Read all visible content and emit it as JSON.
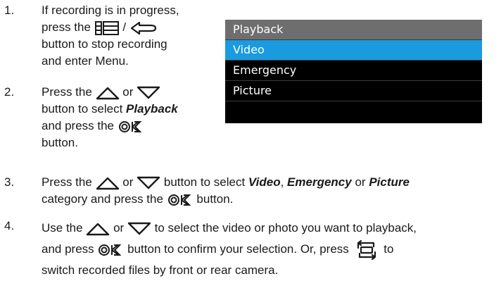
{
  "steps": [
    {
      "number": "1.",
      "line1": "If recording is in progress,",
      "press": "press the",
      "slash": "/",
      "after_icons": "button to stop recording",
      "line4": "and enter Menu.",
      "icons": [
        "menu-list-icon",
        "back-return-icon"
      ]
    },
    {
      "number": "2.",
      "press": "Press the",
      "or": "or",
      "button_to_select": "button to select",
      "target": "Playback",
      "and_press": "and press the",
      "button_end": "button.",
      "icons": [
        "up-arrow-icon",
        "down-arrow-icon",
        "ok-icon"
      ]
    },
    {
      "number": "3.",
      "press": "Press the",
      "or": "or",
      "button_to_select": "button to select",
      "opt1": "Video",
      "comma": ",",
      "opt2": "Emergency",
      "or2": "or",
      "opt3": "Picture",
      "category": "category and press the",
      "button_end": "button.",
      "icons": [
        "up-arrow-icon",
        "down-arrow-icon",
        "ok-icon"
      ]
    },
    {
      "number": "4.",
      "use": "Use the",
      "or": "or",
      "to_select": "to select the video or photo you want to playback,",
      "and_press": "and press",
      "confirm": "button to confirm your selection. Or, press",
      "to": "to",
      "switch": "switch recorded files by front or rear camera.",
      "icons": [
        "up-arrow-icon",
        "down-arrow-icon",
        "ok-icon",
        "camera-switch-icon"
      ]
    }
  ],
  "menu": {
    "items": [
      "Playback",
      "Video",
      "Emergency",
      "Picture"
    ],
    "selected": "Video",
    "colors": {
      "background": "#000000",
      "header": "#6e6e6e",
      "selected": "#1a9be0",
      "text": "#ffffff"
    }
  }
}
